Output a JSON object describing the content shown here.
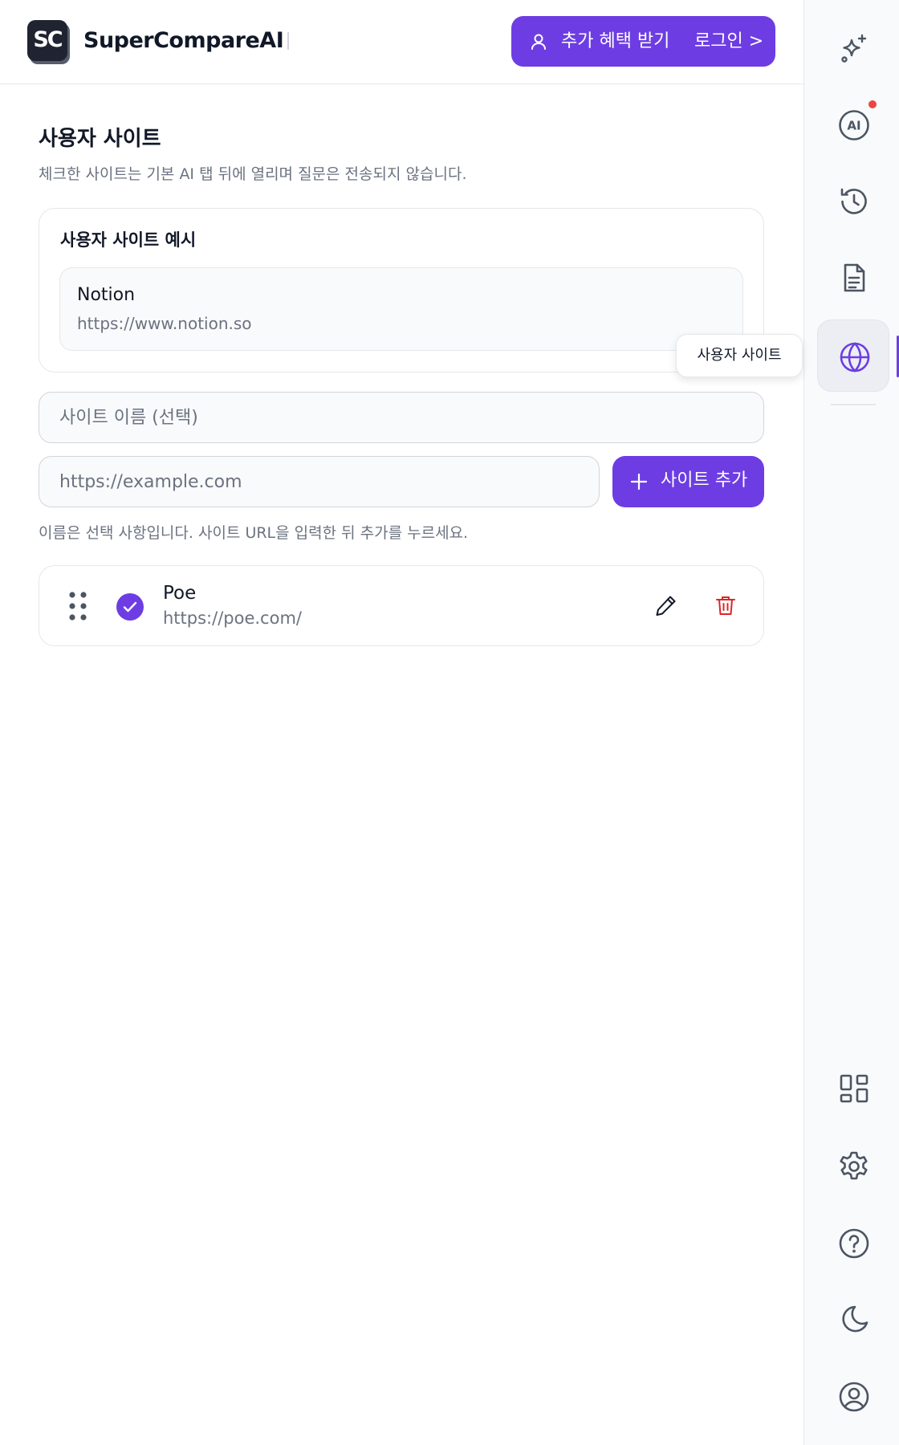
{
  "header": {
    "logo_text": "SC",
    "brand": "SuperCompareAI",
    "promo_label": "추가 혜택 받기",
    "login_label": "로그인 >"
  },
  "section": {
    "title": "사용자 사이트",
    "description": "체크한 사이트는 기본 AI 탭 뒤에 열리며 질문은 전송되지 않습니다."
  },
  "example": {
    "title": "사용자 사이트 예시",
    "name": "Notion",
    "url": "https://www.notion.so"
  },
  "form": {
    "name_placeholder": "사이트 이름 (선택)",
    "url_placeholder": "https://example.com",
    "add_label": "사이트 추가",
    "hint": "이름은 선택 사항입니다. 사이트 URL을 입력한 뒤 추가를 누르세요."
  },
  "sites": [
    {
      "name": "Poe",
      "url": "https://poe.com/",
      "checked": true
    }
  ],
  "rail": {
    "tooltip": "사용자 사이트",
    "ai_badge": "AI",
    "items": [
      "sparkles-icon",
      "ai-icon",
      "history-icon",
      "document-icon",
      "globe-icon",
      "grid-icon",
      "gear-icon",
      "help-icon",
      "moon-icon",
      "account-icon"
    ],
    "notification_color": "#ef4444"
  },
  "colors": {
    "accent": "#6d3de3",
    "danger": "#dc2626"
  }
}
